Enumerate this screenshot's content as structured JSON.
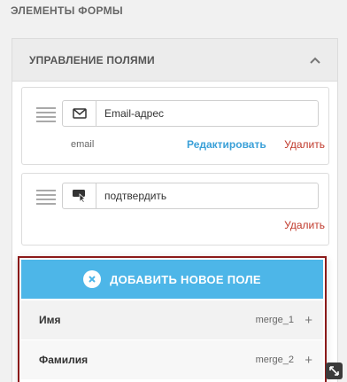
{
  "section_title": "ЭЛЕМЕНТЫ ФОРМЫ",
  "panel": {
    "title": "УПРАВЛЕНИЕ ПОЛЯМИ",
    "collapse_icon": "chevron-up-icon"
  },
  "fields": [
    {
      "icon": "envelope-icon",
      "value": "Email-адрес",
      "key": "email",
      "edit_label": "Редактировать",
      "delete_label": "Удалить"
    },
    {
      "icon": "cursor-click-icon",
      "value": "подтвердить",
      "delete_label": "Удалить"
    }
  ],
  "add_field": {
    "button_label": "ДОБАВИТЬ НОВОЕ ПОЛЕ",
    "button_icon": "close-circle-icon",
    "options": [
      {
        "name": "Имя",
        "merge": "merge_1",
        "add_icon": "plus-icon"
      },
      {
        "name": "Фамилия",
        "merge": "merge_2",
        "add_icon": "plus-icon"
      }
    ]
  },
  "colors": {
    "accent_blue": "#4db6e8",
    "link_blue": "#3aa0d8",
    "delete_red": "#c0392b",
    "popup_border": "#8b1a1a"
  }
}
